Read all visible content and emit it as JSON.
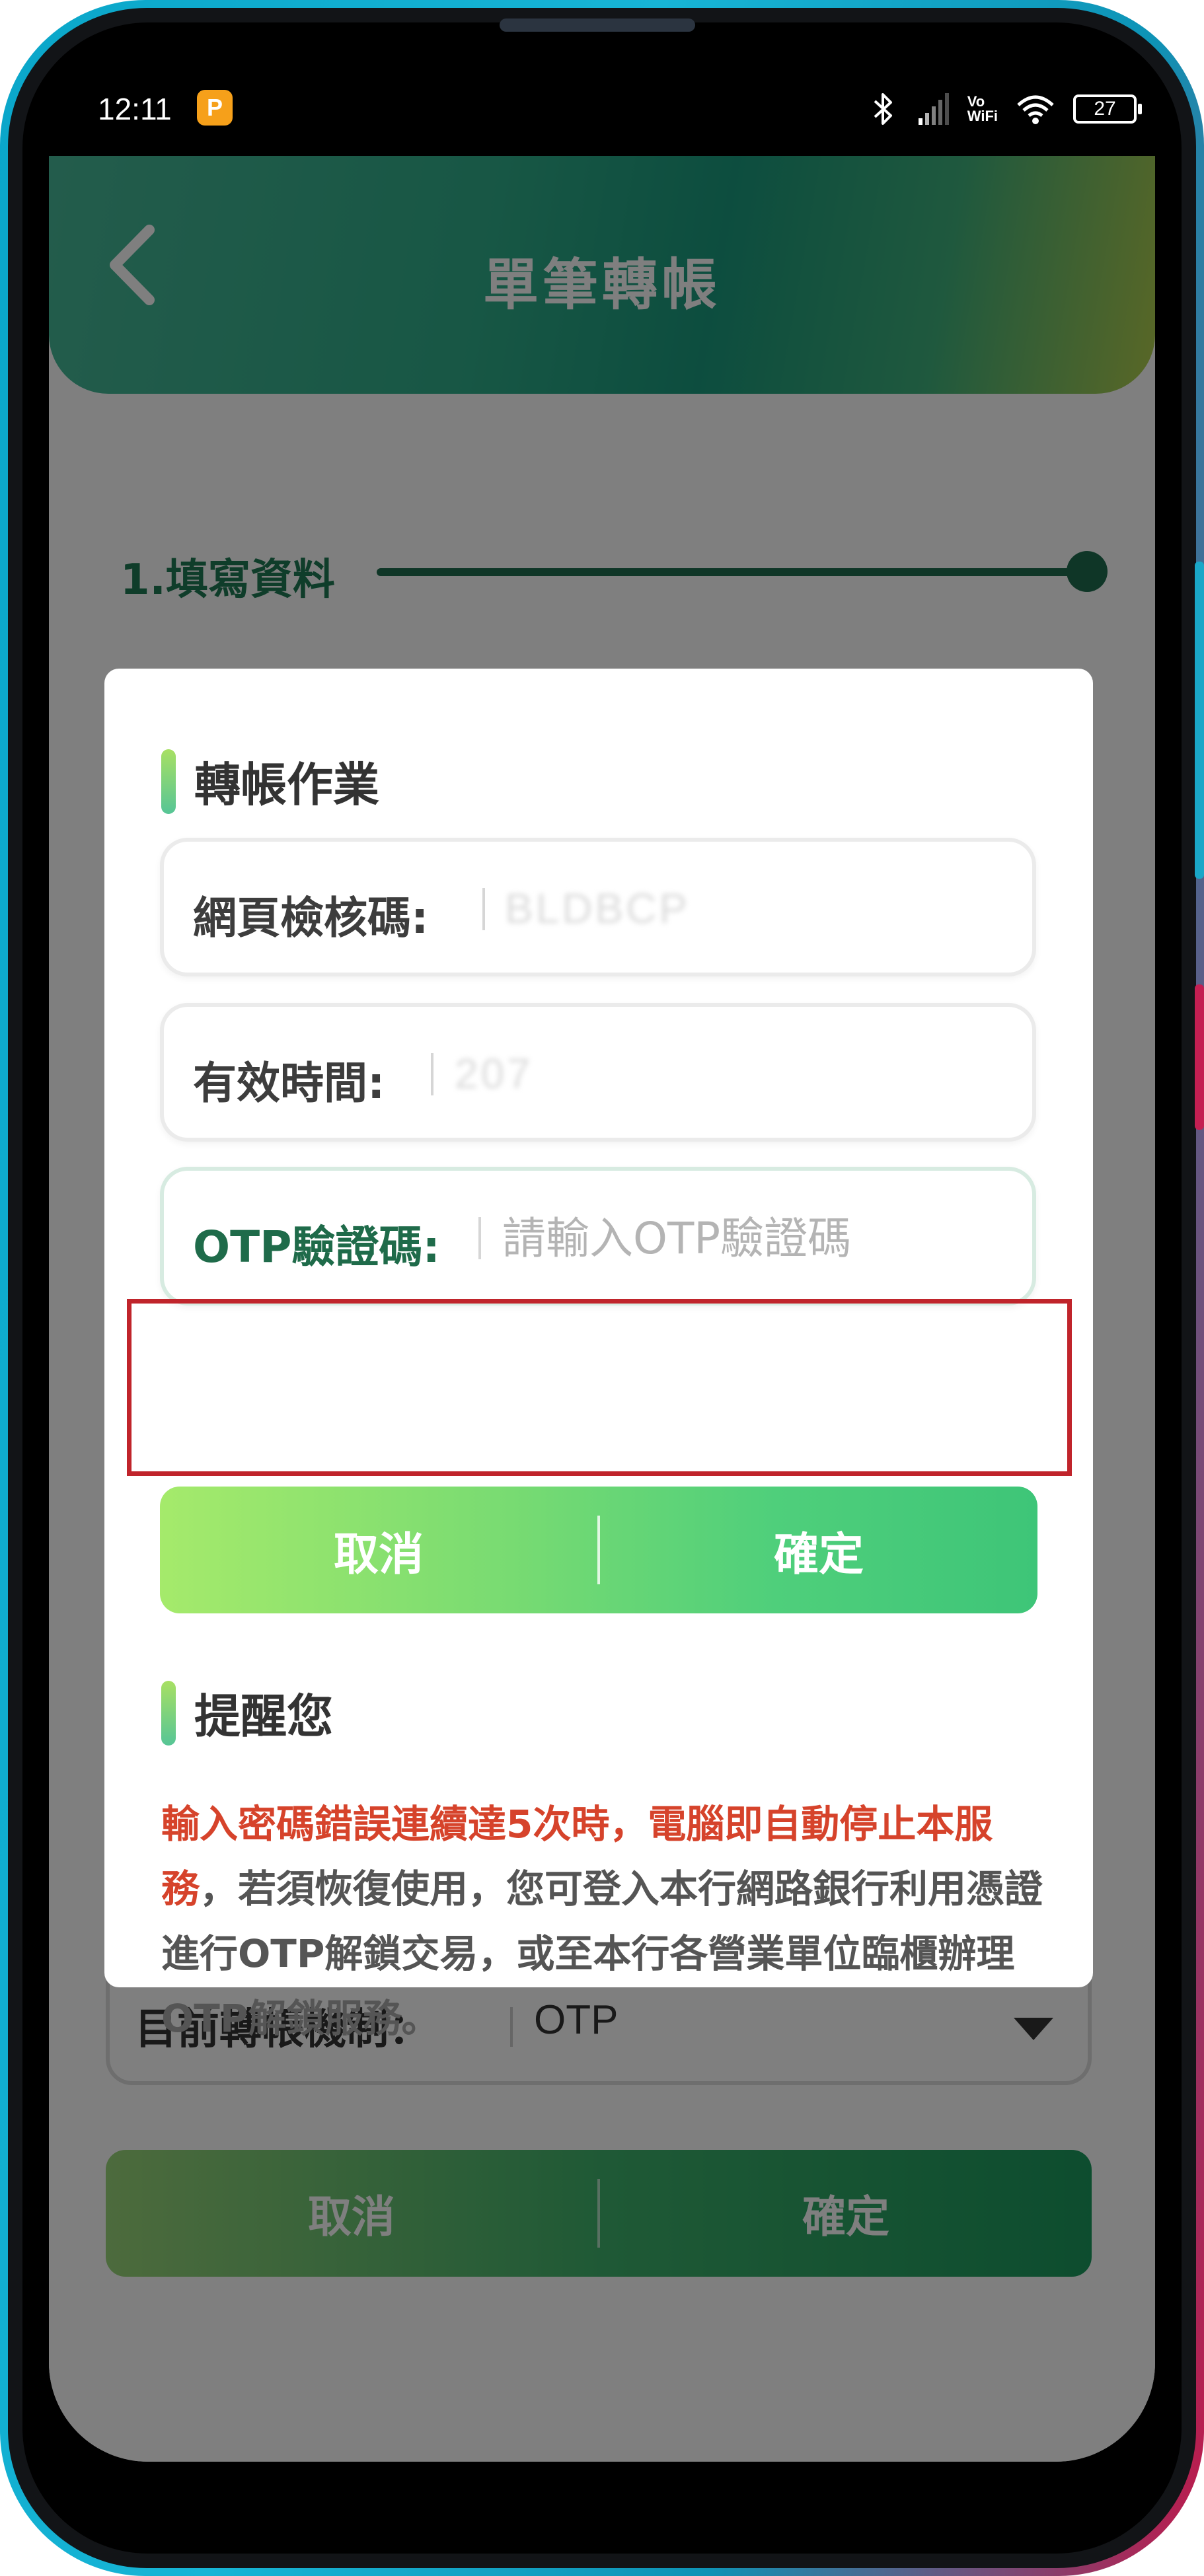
{
  "status_bar": {
    "time": "12:11",
    "notification_app_glyph": "P",
    "vowifi_line1": "Vo",
    "vowifi_line2": "WiFi",
    "battery_level": "27"
  },
  "header": {
    "title": "單筆轉帳"
  },
  "step": {
    "label": "1.填寫資料"
  },
  "background_form": {
    "mechanism_label": "目前轉帳機制：",
    "mechanism_value": "OTP",
    "cancel_label": "取消",
    "confirm_label": "確定"
  },
  "dialog": {
    "section_title": "轉帳作業",
    "fields": {
      "web_check_code": {
        "label": "網頁檢核碼:",
        "value": "BLDBCP"
      },
      "valid_time": {
        "label": "有效時間:",
        "value": "207"
      },
      "otp": {
        "label": "OTP驗證碼:",
        "placeholder": "請輸入OTP驗證碼"
      }
    },
    "cancel_label": "取消",
    "confirm_label": "確定",
    "reminder_title": "提醒您",
    "reminder_warning": "輸入密碼錯誤連續達5次時，電腦即自動停止本服務",
    "reminder_rest": "，若須恢復使用，您可登入本行網路銀行利用憑證進行OTP解鎖交易，或至本行各營業單位臨櫃辦理OTP解鎖服務。"
  },
  "colors": {
    "header_gradient_start": "#47b998",
    "header_gradient_end": "#b3cf4d",
    "button_gradient_start": "#a5ea6b",
    "button_gradient_end": "#3ec578",
    "warning_text": "#d6432b",
    "highlight_box": "#c0242b",
    "otp_label": "#1f6b4a"
  },
  "icons": {
    "back": "chevron-left-icon",
    "bluetooth": "bluetooth-icon",
    "signal": "signal-icon",
    "wifi": "wifi-icon",
    "battery": "battery-icon",
    "dropdown": "caret-down-icon"
  }
}
